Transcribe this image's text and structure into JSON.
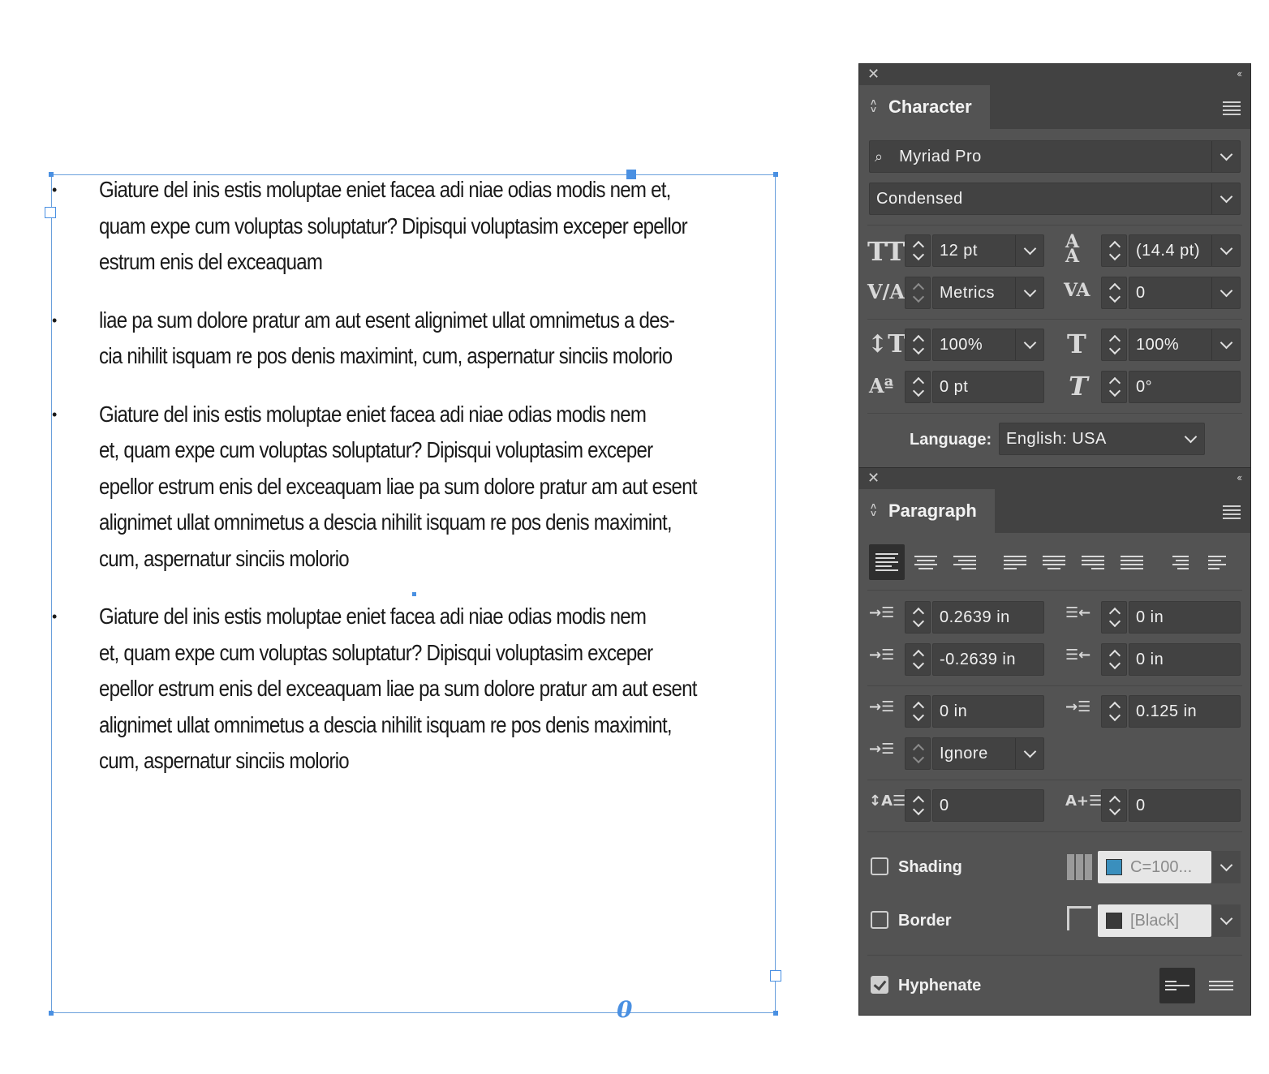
{
  "story": {
    "paragraphs": [
      {
        "bullet": "•",
        "lines": [
          "Giature del inis estis moluptae eniet facea adi niae odias modis nem et,",
          "quam expe cum voluptas soluptatur? Dipisqui voluptasim exceper epellor",
          "estrum enis del exceaquam"
        ]
      },
      {
        "bullet": "•",
        "lines": [
          "liae pa sum dolore pratur am aut esent alignimet ullat omnimetus a des-",
          "cia nihilit isquam re pos denis maximint, cum, aspernatur sinciis molorio"
        ]
      },
      {
        "bullet": "•",
        "lines": [
          "Giature del inis estis moluptae eniet facea adi niae odias modis nem",
          "et, quam expe cum voluptas soluptatur? Dipisqui voluptasim exceper",
          "epellor estrum enis del exceaquam liae pa sum dolore pratur am aut esent",
          "alignimet ullat omnimetus a descia nihilit isquam re pos denis maximint,",
          "cum, aspernatur sinciis molorio"
        ]
      },
      {
        "bullet": "•",
        "lines": [
          "Giature del inis estis moluptae eniet facea adi niae odias modis nem",
          "et, quam expe cum voluptas soluptatur? Dipisqui voluptasim exceper",
          "epellor estrum enis del exceaquam liae pa sum dolore pratur am aut esent",
          "alignimet ullat omnimetus a descia nihilit isquam re pos denis maximint,",
          "cum, aspernatur sinciis molorio"
        ]
      }
    ],
    "overset_marker": "0"
  },
  "character": {
    "title": "Character",
    "font_family": "Myriad Pro",
    "font_style": "Condensed",
    "font_size": "12 pt",
    "leading": "(14.4 pt)",
    "kerning": "Metrics",
    "tracking": "0",
    "vertical_scale": "100%",
    "horizontal_scale": "100%",
    "baseline_shift": "0 pt",
    "skew": "0°",
    "language_label": "Language:",
    "language": "English: USA"
  },
  "paragraph": {
    "title": "Paragraph",
    "left_indent": "0.2639 in",
    "right_indent": "0 in",
    "first_line_indent": "-0.2639 in",
    "last_line_right_indent": "0 in",
    "space_before": "0 in",
    "space_after": "0.125 in",
    "align_to_grid": "Ignore",
    "drop_cap_lines": "0",
    "drop_cap_chars": "0",
    "shading_label": "Shading",
    "shading_color": "C=100...",
    "shading_swatch": "#3a8fbd",
    "shading_checked": false,
    "border_label": "Border",
    "border_color": "[Black]",
    "border_swatch": "#3a3a3a",
    "border_checked": false,
    "hyphenate_label": "Hyphenate",
    "hyphenate_checked": true
  },
  "colors": {
    "panel_bg": "#535353",
    "frame_accent": "#4a90e2"
  }
}
